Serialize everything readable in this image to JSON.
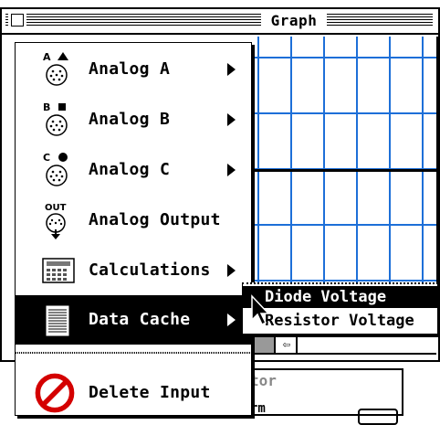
{
  "window": {
    "title": "Graph"
  },
  "popup_menu": {
    "items": [
      {
        "label": "Analog A",
        "icon": "analog-a-connector-icon",
        "icon_letter": "A",
        "has_submenu": true
      },
      {
        "label": "Analog B",
        "icon": "analog-b-connector-icon",
        "icon_letter": "B",
        "has_submenu": true
      },
      {
        "label": "Analog C",
        "icon": "analog-c-connector-icon",
        "icon_letter": "C",
        "has_submenu": true
      },
      {
        "label": "Analog Output",
        "icon": "analog-output-connector-icon",
        "icon_letter": "OUT",
        "has_submenu": false
      },
      {
        "label": "Calculations",
        "icon": "calculator-icon",
        "has_submenu": true
      },
      {
        "label": "Data Cache",
        "icon": "data-cache-icon",
        "has_submenu": true,
        "selected": true
      },
      {
        "label": "Delete Input",
        "icon": "delete-prohibited-icon",
        "has_submenu": false
      }
    ]
  },
  "submenu": {
    "items": [
      {
        "label": "Diode Voltage",
        "selected": true
      },
      {
        "label": "Resistor Voltage",
        "selected": false
      }
    ]
  },
  "lower_window": {
    "title": "tor",
    "sub": "rm"
  },
  "colors": {
    "grid": "#1d6fd8",
    "menu_highlight": "#000000"
  }
}
